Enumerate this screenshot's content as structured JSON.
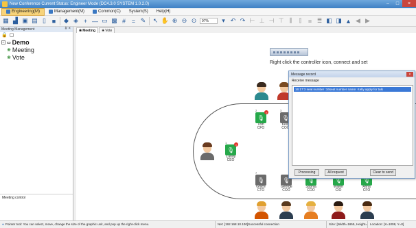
{
  "window": {
    "title": "New Conference  Current Status: Engineer Mode (DC4.3.0 SYSTEM 1.0.2.0)",
    "controls": [
      "–",
      "□",
      "×"
    ]
  },
  "menu": [
    {
      "label": "Engineering(M)",
      "active": true
    },
    {
      "label": "Management(M)",
      "active": false
    },
    {
      "label": "Common(C)",
      "active": false
    },
    {
      "label": "System(S)",
      "active": false
    },
    {
      "label": "Help(H)",
      "active": false
    }
  ],
  "toolbar": {
    "zoom_value": "97%"
  },
  "sidepanel": {
    "title": "Meeting Management",
    "pin": "# ×",
    "tree": {
      "root": "Demo",
      "children": [
        "Meeting",
        "Vote"
      ]
    },
    "meeting_control": "Meeting control"
  },
  "tabs": [
    {
      "label": "Meeting",
      "active": true
    },
    {
      "label": "Vote",
      "active": false
    }
  ],
  "canvas": {
    "hint": "Right click the controller icon, connect and set",
    "seats": [
      {
        "num": "1",
        "name": "Candy",
        "role": "CEO",
        "mic": "green",
        "badge": true
      },
      {
        "num": "2",
        "name": "Tom",
        "role": "CFO",
        "mic": "green",
        "badge": true
      },
      {
        "num": "3",
        "name": "Kelly",
        "role": "COO",
        "mic": "gray",
        "badge": false
      },
      {
        "num": "7",
        "name": "Grace",
        "role": "CTO",
        "mic": "gray",
        "badge": false
      },
      {
        "num": "",
        "name": "George",
        "role": "COO",
        "mic": "gray",
        "badge": false
      },
      {
        "num": "",
        "name": "Sophia",
        "role": "COO",
        "mic": "green",
        "badge": false
      },
      {
        "num": "",
        "name": "Walter",
        "role": "CIO",
        "mic": "green",
        "badge": false
      },
      {
        "num": "",
        "name": "Anna",
        "role": "CFO",
        "mic": "green",
        "badge": false
      }
    ]
  },
  "dialog": {
    "title": "Message record",
    "subtitle": "Receive message",
    "messages": [
      "16:17:3 seat number :16seat number name: Kelly apply for talk"
    ],
    "buttons": {
      "processing": "Processing",
      "all_request": "All request",
      "clear_to_send": "Clear to send"
    }
  },
  "statusbar": {
    "tip": "Pointer tool: You can select, move, change the size of the graphic unit, and pop up the right-click menu.",
    "net": "Net: [192.168.10.100]Successful connection",
    "size": "Size: [Width=1655, Height=950]",
    "location": "Location: [X=1008, Y=0]"
  },
  "colors": {
    "accent": "#3a78c2",
    "mic_green": "#26a84a",
    "mic_gray": "#6b6b6b",
    "menu_active": "#f7d37a"
  }
}
